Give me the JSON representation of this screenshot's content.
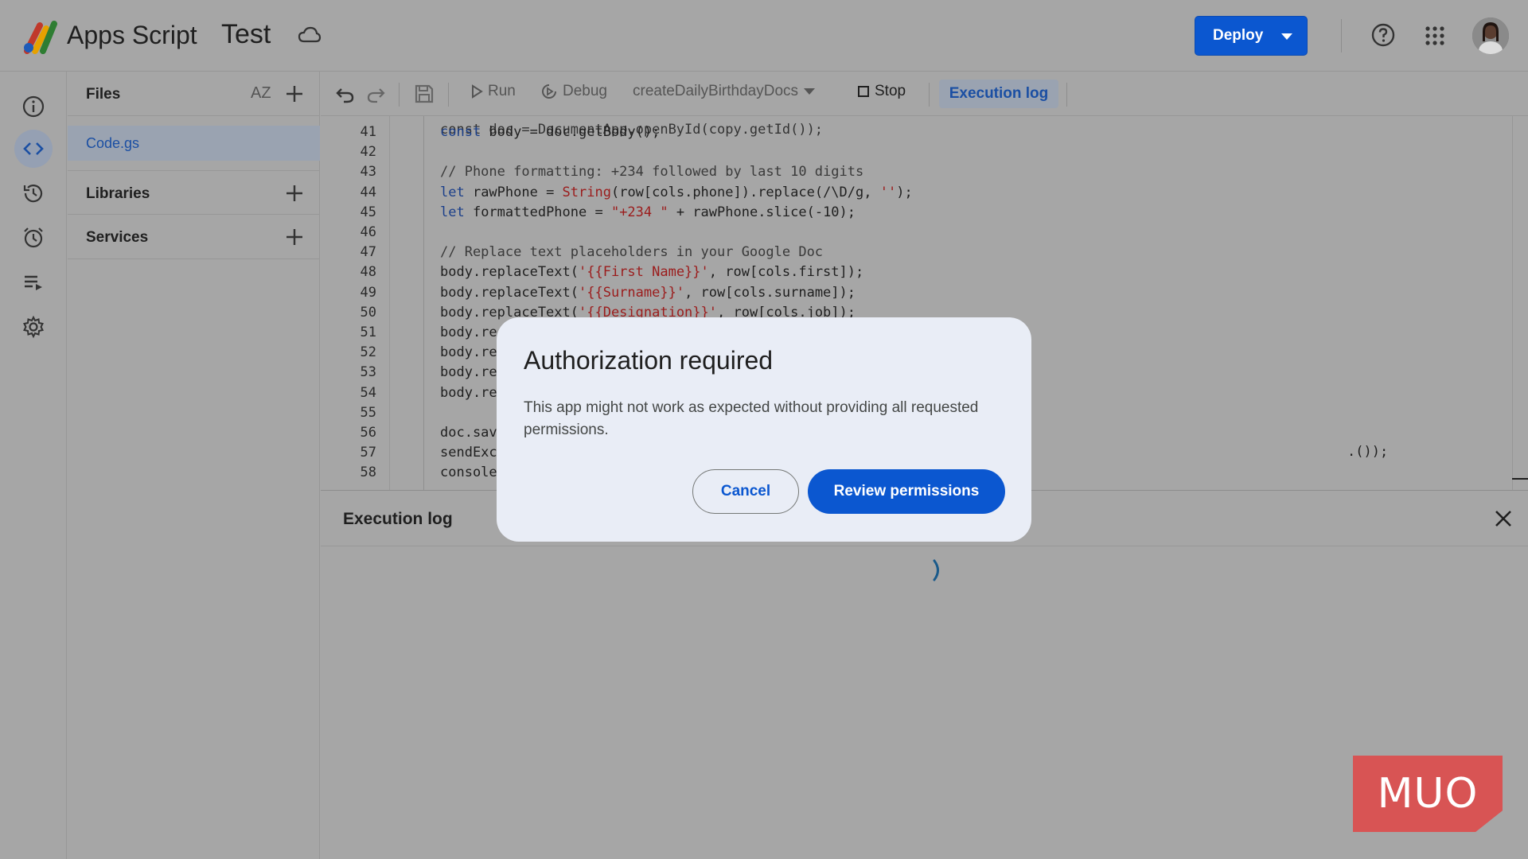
{
  "header": {
    "app_name": "Apps Script",
    "project_name": "Test",
    "deploy_label": "Deploy"
  },
  "rail": {
    "items": [
      "overview",
      "editor",
      "project-history",
      "triggers",
      "executions",
      "project-settings"
    ],
    "active": "editor"
  },
  "files_panel": {
    "title": "Files",
    "sort_label": "AZ",
    "files": [
      {
        "name": "Code.gs",
        "selected": true
      }
    ],
    "sections": [
      {
        "label": "Libraries"
      },
      {
        "label": "Services"
      }
    ]
  },
  "toolbar": {
    "run_label": "Run",
    "debug_label": "Debug",
    "function_name": "createDailyBirthdayDocs",
    "stop_label": "Stop",
    "execution_log_label": "Execution log"
  },
  "code": {
    "partial_top_line": "const doc = DocumentApp.openById(copy.getId());",
    "lines": [
      {
        "n": "41",
        "text": "const body = doc.getBody();"
      },
      {
        "n": "42",
        "text": ""
      },
      {
        "n": "43",
        "text": "// Phone formatting: +234 followed by last 10 digits"
      },
      {
        "n": "44",
        "text": "let rawPhone = String(row[cols.phone]).replace(/\\D/g, '');"
      },
      {
        "n": "45",
        "text": "let formattedPhone = \"+234 \" + rawPhone.slice(-10);"
      },
      {
        "n": "46",
        "text": ""
      },
      {
        "n": "47",
        "text": "// Replace text placeholders in your Google Doc"
      },
      {
        "n": "48",
        "text": "body.replaceText('{{First Name}}', row[cols.first]);"
      },
      {
        "n": "49",
        "text": "body.replaceText('{{Surname}}', row[cols.surname]);"
      },
      {
        "n": "50",
        "text": "body.replaceText('{{Designation}}', row[cols.job]);"
      },
      {
        "n": "51",
        "text": "body.re"
      },
      {
        "n": "52",
        "text": "body.re"
      },
      {
        "n": "53",
        "text": "body.re"
      },
      {
        "n": "54",
        "text": "body.re"
      },
      {
        "n": "55",
        "text": ""
      },
      {
        "n": "56",
        "text": "doc.sav"
      },
      {
        "n": "57",
        "text": "sendExc"
      },
      {
        "n": "58",
        "text": "console"
      }
    ],
    "line_57_tail": ".());"
  },
  "log_panel": {
    "title": "Execution log"
  },
  "dialog": {
    "title": "Authorization required",
    "body": "This app might not work as expected without providing all requested permissions.",
    "cancel_label": "Cancel",
    "confirm_label": "Review permissions"
  },
  "watermark": {
    "text": "MUO"
  },
  "colors": {
    "primary": "#0b57d0",
    "dialog_bg": "#e9edf6",
    "overlay_bg": "#a6a6a6",
    "watermark": "#d85454"
  }
}
